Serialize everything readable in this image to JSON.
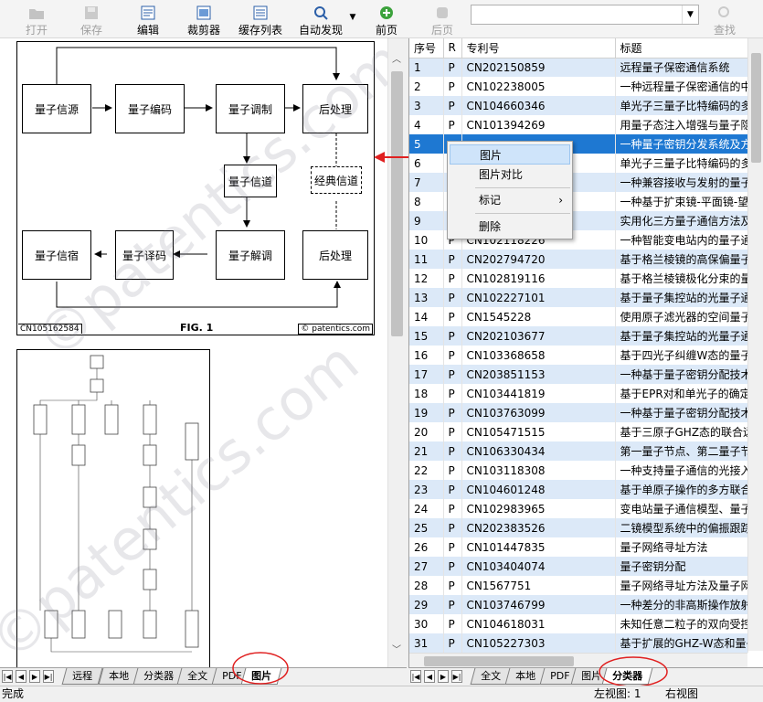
{
  "toolbar": {
    "open": "打开",
    "save": "保存",
    "edit": "编辑",
    "clipper": "裁剪器",
    "cache_list": "缓存列表",
    "auto_discover": "自动发现",
    "prev": "前页",
    "next": "后页",
    "search_value": "",
    "find": "查找"
  },
  "figure1": {
    "boxes": {
      "source": "量子信源",
      "encode": "量子编码",
      "modulate": "量子调制",
      "post1": "后处理",
      "channel": "量子信道",
      "classic": "经典信道",
      "sink": "量子信宿",
      "decode": "量子译码",
      "demod": "量子解调",
      "post2": "后处理"
    },
    "id_label": "CN105162584",
    "fig_label": "FIG. 1",
    "copyright": "© patentics.com"
  },
  "watermark": "©patentics.com",
  "left_tabs": [
    "远程",
    "本地",
    "分类器",
    "全文",
    "PDF",
    "图片"
  ],
  "left_active_tab": "图片",
  "table": {
    "headers": [
      "序号",
      "R",
      "专利号",
      "标题"
    ],
    "rows": [
      [
        "1",
        "P",
        "CN202150859",
        "远程量子保密通信系统"
      ],
      [
        "2",
        "P",
        "CN102238005",
        "一种远程量子保密通信的中"
      ],
      [
        "3",
        "P",
        "CN104660346",
        "单光子三量子比特编码的多"
      ],
      [
        "4",
        "P",
        "CN101394269",
        "用量子态注入增强与量子隐"
      ],
      [
        "5",
        "",
        "",
        "一种量子密钥分发系统及方"
      ],
      [
        "6",
        "",
        "",
        "单光子三量子比特编码的多"
      ],
      [
        "7",
        "",
        "",
        "一种兼容接收与发射的量子"
      ],
      [
        "8",
        "",
        "",
        "一种基于扩束镜-平面镜-望"
      ],
      [
        "9",
        "",
        "",
        "实用化三方量子通信方法及"
      ],
      [
        "10",
        "P",
        "CN102118226",
        "一种智能变电站内的量子通"
      ],
      [
        "11",
        "P",
        "CN202794720",
        "基于格兰棱镜的高保偏量子"
      ],
      [
        "12",
        "P",
        "CN102819116",
        "基于格兰棱镜极化分束的量"
      ],
      [
        "13",
        "P",
        "CN102227101",
        "基于量子集控站的光量子通"
      ],
      [
        "14",
        "P",
        "CN1545228",
        "使用原子滤光器的空间量子"
      ],
      [
        "15",
        "P",
        "CN202103677",
        "基于量子集控站的光量子通"
      ],
      [
        "16",
        "P",
        "CN103368658",
        "基于四光子纠缠W态的量子"
      ],
      [
        "17",
        "P",
        "CN203851153",
        "一种基于量子密钥分配技术"
      ],
      [
        "18",
        "P",
        "CN103441819",
        "基于EPR对和单光子的确定"
      ],
      [
        "19",
        "P",
        "CN103763099",
        "一种基于量子密钥分配技术"
      ],
      [
        "20",
        "P",
        "CN105471515",
        "基于三原子GHZ态的联合远"
      ],
      [
        "21",
        "P",
        "CN106330434",
        "第一量子节点、第二量子节"
      ],
      [
        "22",
        "P",
        "CN103118308",
        "一种支持量子通信的光接入"
      ],
      [
        "23",
        "P",
        "CN104601248",
        "基于单原子操作的多方联合"
      ],
      [
        "24",
        "P",
        "CN102983965",
        "变电站量子通信模型、量子"
      ],
      [
        "25",
        "P",
        "CN202383526",
        "二镜模型系统中的偏振跟踪"
      ],
      [
        "26",
        "P",
        "CN101447835",
        "量子网络寻址方法"
      ],
      [
        "27",
        "P",
        "CN103404074",
        "量子密钥分配"
      ],
      [
        "28",
        "P",
        "CN1567751",
        "量子网络寻址方法及量子网"
      ],
      [
        "29",
        "P",
        "CN103746799",
        "一种差分的非高斯操作放射"
      ],
      [
        "30",
        "P",
        "CN104618031",
        "未知任意二粒子的双向受控"
      ],
      [
        "31",
        "P",
        "CN105227303",
        "基于扩展的GHZ-W态和量子"
      ]
    ]
  },
  "context_menu": {
    "items": [
      "图片",
      "图片对比",
      "标记",
      "删除"
    ],
    "submenu_arrow": "›"
  },
  "right_tabs": [
    "全文",
    "本地",
    "PDF",
    "图片",
    "分类器"
  ],
  "right_active_tab": "分类器",
  "status": {
    "left": "完成",
    "left_view": "左视图: 1",
    "right_view": "右视图"
  },
  "colors": {
    "selection": "#1e78d2",
    "alt_row": "#dce9f8",
    "highlight_circle": "#e02020",
    "arrow": "#e02020"
  }
}
